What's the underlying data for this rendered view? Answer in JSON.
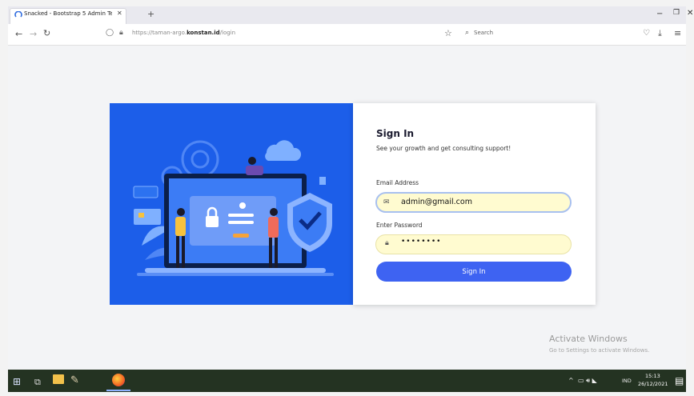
{
  "browser": {
    "tab_title": "Snacked - Bootstrap 5 Admin Te",
    "tab_close": "✕",
    "new_tab": "+",
    "url_prefix": "https://taman-argo.",
    "url_domain": "konstan.id",
    "url_path": "/login",
    "search_placeholder": "Search",
    "window_controls": {
      "minimize": "−",
      "maximize": "❐",
      "close": "✕"
    }
  },
  "login": {
    "title": "Sign In",
    "subtitle": "See your growth and get consulting support!",
    "email_label": "Email Address",
    "email_value": "admin@gmail.com",
    "password_label": "Enter Password",
    "password_value": "••••••••",
    "submit_label": "Sign In"
  },
  "watermark": {
    "title": "Activate Windows",
    "subtitle": "Go to Settings to activate Windows."
  },
  "taskbar": {
    "language": "IND",
    "time": "15:13",
    "date": "26/12/2021"
  },
  "colors": {
    "illustration_bg": "#1c5ee9",
    "button": "#3e63f2",
    "autofill": "#fffbd0"
  },
  "icons": [
    "firefox-icon",
    "lock-icon",
    "shield-icon",
    "star-icon",
    "search-icon",
    "mail-icon",
    "key-icon",
    "start-icon"
  ]
}
